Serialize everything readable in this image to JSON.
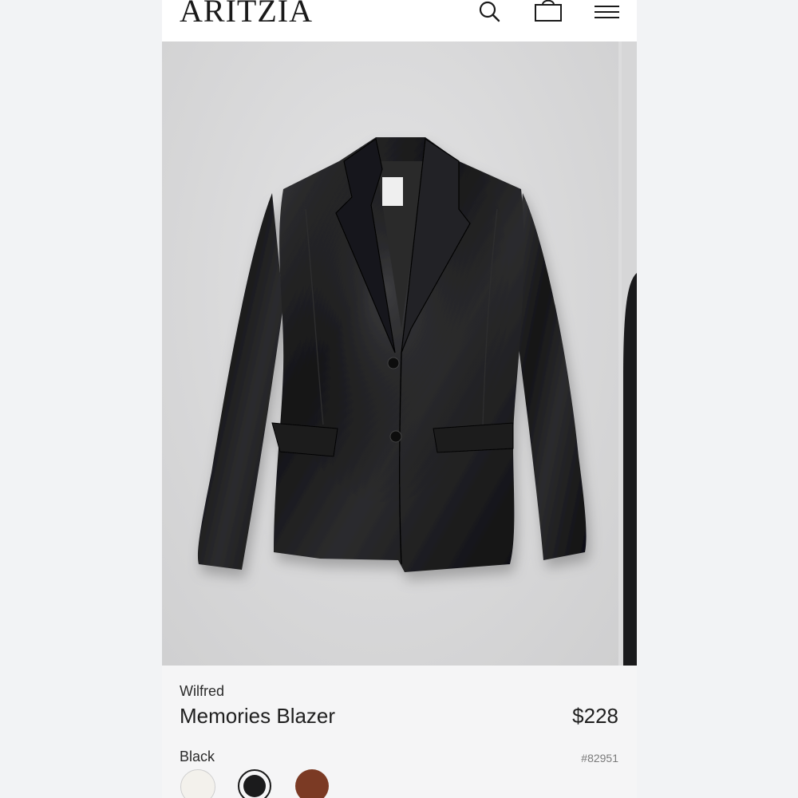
{
  "header": {
    "logo": "ARITZIA",
    "icons": [
      "search-icon",
      "shopping-bag-icon",
      "hamburger-menu-icon"
    ]
  },
  "product": {
    "brand": "Wilfred",
    "name": "Memories Blazer",
    "price": "$228",
    "selected_color": "Black",
    "sku": "#82951",
    "swatches": [
      {
        "name": "white",
        "color": "#f3f1ec"
      },
      {
        "name": "black",
        "color": "#1b1b1c",
        "selected": true
      },
      {
        "name": "brown",
        "color": "#7b3a24"
      }
    ]
  },
  "colors": {
    "background": "#f2f3f5",
    "header": "#ffffff",
    "text": "#1f1f1f",
    "muted": "#7b7b7b"
  }
}
